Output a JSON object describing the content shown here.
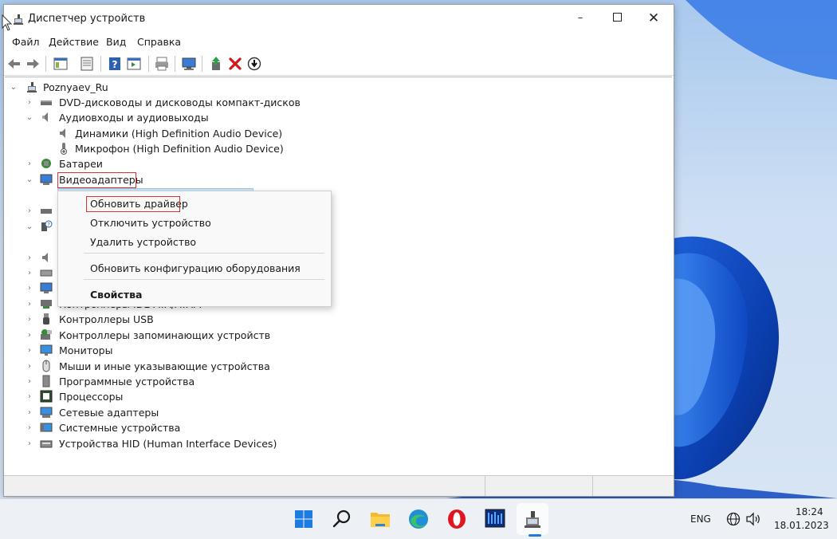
{
  "window": {
    "title": "Диспетчер устройств",
    "controls": {
      "minimize": "–",
      "maximize": "",
      "close": "✕"
    }
  },
  "menubar": [
    "Файл",
    "Действие",
    "Вид",
    "Справка"
  ],
  "toolbar": {
    "buttons": [
      "back-icon",
      "forward-icon",
      "show-hide-console-tree-icon",
      "properties-icon",
      "help-icon",
      "action-pane-icon",
      "print-icon",
      "scan-hardware-icon",
      "update-driver-icon",
      "uninstall-icon",
      "disable-icon"
    ]
  },
  "tree": {
    "root": "Poznyaev_Ru",
    "items": [
      {
        "label": "DVD-дисководы и дисководы компакт-дисков",
        "icon": "dvd-drive-icon"
      },
      {
        "label": "Аудиовходы и аудиовыходы",
        "icon": "speaker-icon",
        "expanded": true,
        "children": [
          "Динамики (High Definition Audio Device)",
          "Микрофон (High Definition Audio Device)"
        ]
      },
      {
        "label": "Батареи",
        "icon": "battery-icon"
      },
      {
        "label": "Видеоадаптеры",
        "icon": "display-adapter-icon",
        "expanded": true,
        "highlighted": true
      },
      {
        "label": "Контроллеры USB",
        "icon": "usb-icon"
      },
      {
        "label": "Контроллеры запоминающих устройств",
        "icon": "storage-controller-icon"
      },
      {
        "label": "Мониторы",
        "icon": "monitor-icon"
      },
      {
        "label": "Мыши и иные указывающие устройства",
        "icon": "mouse-icon"
      },
      {
        "label": "Программные устройства",
        "icon": "software-device-icon"
      },
      {
        "label": "Процессоры",
        "icon": "processor-icon"
      },
      {
        "label": "Сетевые адаптеры",
        "icon": "network-adapter-icon"
      },
      {
        "label": "Системные устройства",
        "icon": "system-device-icon"
      },
      {
        "label": "Устройства HID (Human Interface Devices)",
        "icon": "hid-icon"
      }
    ],
    "partially_hidden_label": "Контроллеры IDE ATA/ATAPI"
  },
  "context_menu": {
    "items": [
      "Обновить драйвер",
      "Отключить устройство",
      "Удалить устройство"
    ],
    "scan": "Обновить конфигурацию оборудования",
    "properties": "Свойства"
  },
  "taskbar": {
    "apps": [
      "windows-start-icon",
      "search-icon",
      "file-explorer-icon",
      "edge-icon",
      "opera-icon",
      "monitor-app-icon",
      "device-manager-icon"
    ],
    "tray": {
      "language": "ENG",
      "time": "18:24",
      "date": "18.01.2023"
    }
  },
  "colors": {
    "highlight_box": "#e03030",
    "selection": "#cce4f7",
    "taskbar": "#edf1f6"
  }
}
